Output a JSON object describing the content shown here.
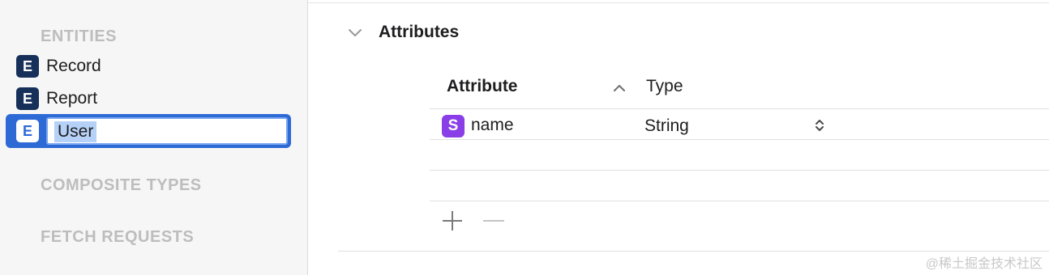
{
  "sidebar": {
    "entities_heading": "ENTITIES",
    "entities": [
      {
        "badge": "E",
        "label": "Record"
      },
      {
        "badge": "E",
        "label": "Report"
      },
      {
        "badge": "E",
        "label": "User",
        "selected": true,
        "editing": true
      }
    ],
    "composite_heading": "COMPOSITE TYPES",
    "fetch_heading": "FETCH REQUESTS"
  },
  "attributes": {
    "section_title": "Attributes",
    "columns": {
      "attribute": "Attribute",
      "type": "Type"
    },
    "rows": [
      {
        "badge": "S",
        "name": "name",
        "type": "String"
      }
    ],
    "add_symbol": "+",
    "remove_symbol": "−"
  },
  "watermark": "@稀土掘金技术社区",
  "colors": {
    "selection": "#2e6ad6",
    "entity_badge": "#17305a",
    "string_badge": "#8a3ee8"
  },
  "icons": [
    "disclosure-chevron-down-icon",
    "sort-ascending-icon",
    "popup-stepper-icon",
    "add-icon",
    "remove-icon"
  ]
}
